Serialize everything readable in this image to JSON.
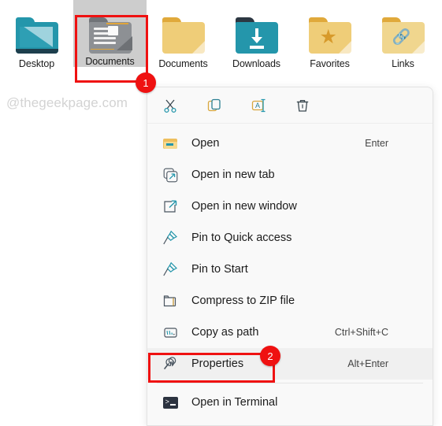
{
  "folder_strip": {
    "items": [
      {
        "label": "Desktop",
        "icon": "folder-desktop-icon",
        "selected": false
      },
      {
        "label": "Documents",
        "icon": "folder-documents-icon",
        "selected": true
      },
      {
        "label": "Documents",
        "icon": "folder-plain-icon",
        "selected": false
      },
      {
        "label": "Downloads",
        "icon": "folder-downloads-icon",
        "selected": false
      },
      {
        "label": "Favorites",
        "icon": "folder-favorites-icon",
        "selected": false
      },
      {
        "label": "Links",
        "icon": "folder-links-icon",
        "selected": false
      }
    ]
  },
  "watermark": {
    "text": "@thegeekpage.com"
  },
  "context_menu": {
    "command_bar": [
      {
        "name": "cut-icon",
        "glyph": "✂"
      },
      {
        "name": "copy-icon",
        "glyph": "⧉"
      },
      {
        "name": "rename-icon",
        "glyph": "A"
      },
      {
        "name": "delete-icon",
        "glyph": "Ὕ1"
      }
    ],
    "items": [
      {
        "label": "Open",
        "shortcut": "Enter",
        "icon": "open-folder-icon",
        "highlight": false
      },
      {
        "label": "Open in new tab",
        "shortcut": "",
        "icon": "new-tab-icon",
        "highlight": false
      },
      {
        "label": "Open in new window",
        "shortcut": "",
        "icon": "new-window-icon",
        "highlight": false
      },
      {
        "label": "Pin to Quick access",
        "shortcut": "",
        "icon": "pin-icon",
        "highlight": false
      },
      {
        "label": "Pin to Start",
        "shortcut": "",
        "icon": "pin-icon",
        "highlight": false
      },
      {
        "label": "Compress to ZIP file",
        "shortcut": "",
        "icon": "zip-icon",
        "highlight": false
      },
      {
        "label": "Copy as path",
        "shortcut": "Ctrl+Shift+C",
        "icon": "copy-path-icon",
        "highlight": false
      },
      {
        "label": "Properties",
        "shortcut": "Alt+Enter",
        "icon": "wrench-icon",
        "highlight": true
      },
      {
        "label": "Open in Terminal",
        "shortcut": "",
        "icon": "terminal-icon",
        "highlight": false
      }
    ]
  },
  "annotations": {
    "badge_1": "1",
    "badge_2": "2",
    "box_color": "#ef1111"
  }
}
